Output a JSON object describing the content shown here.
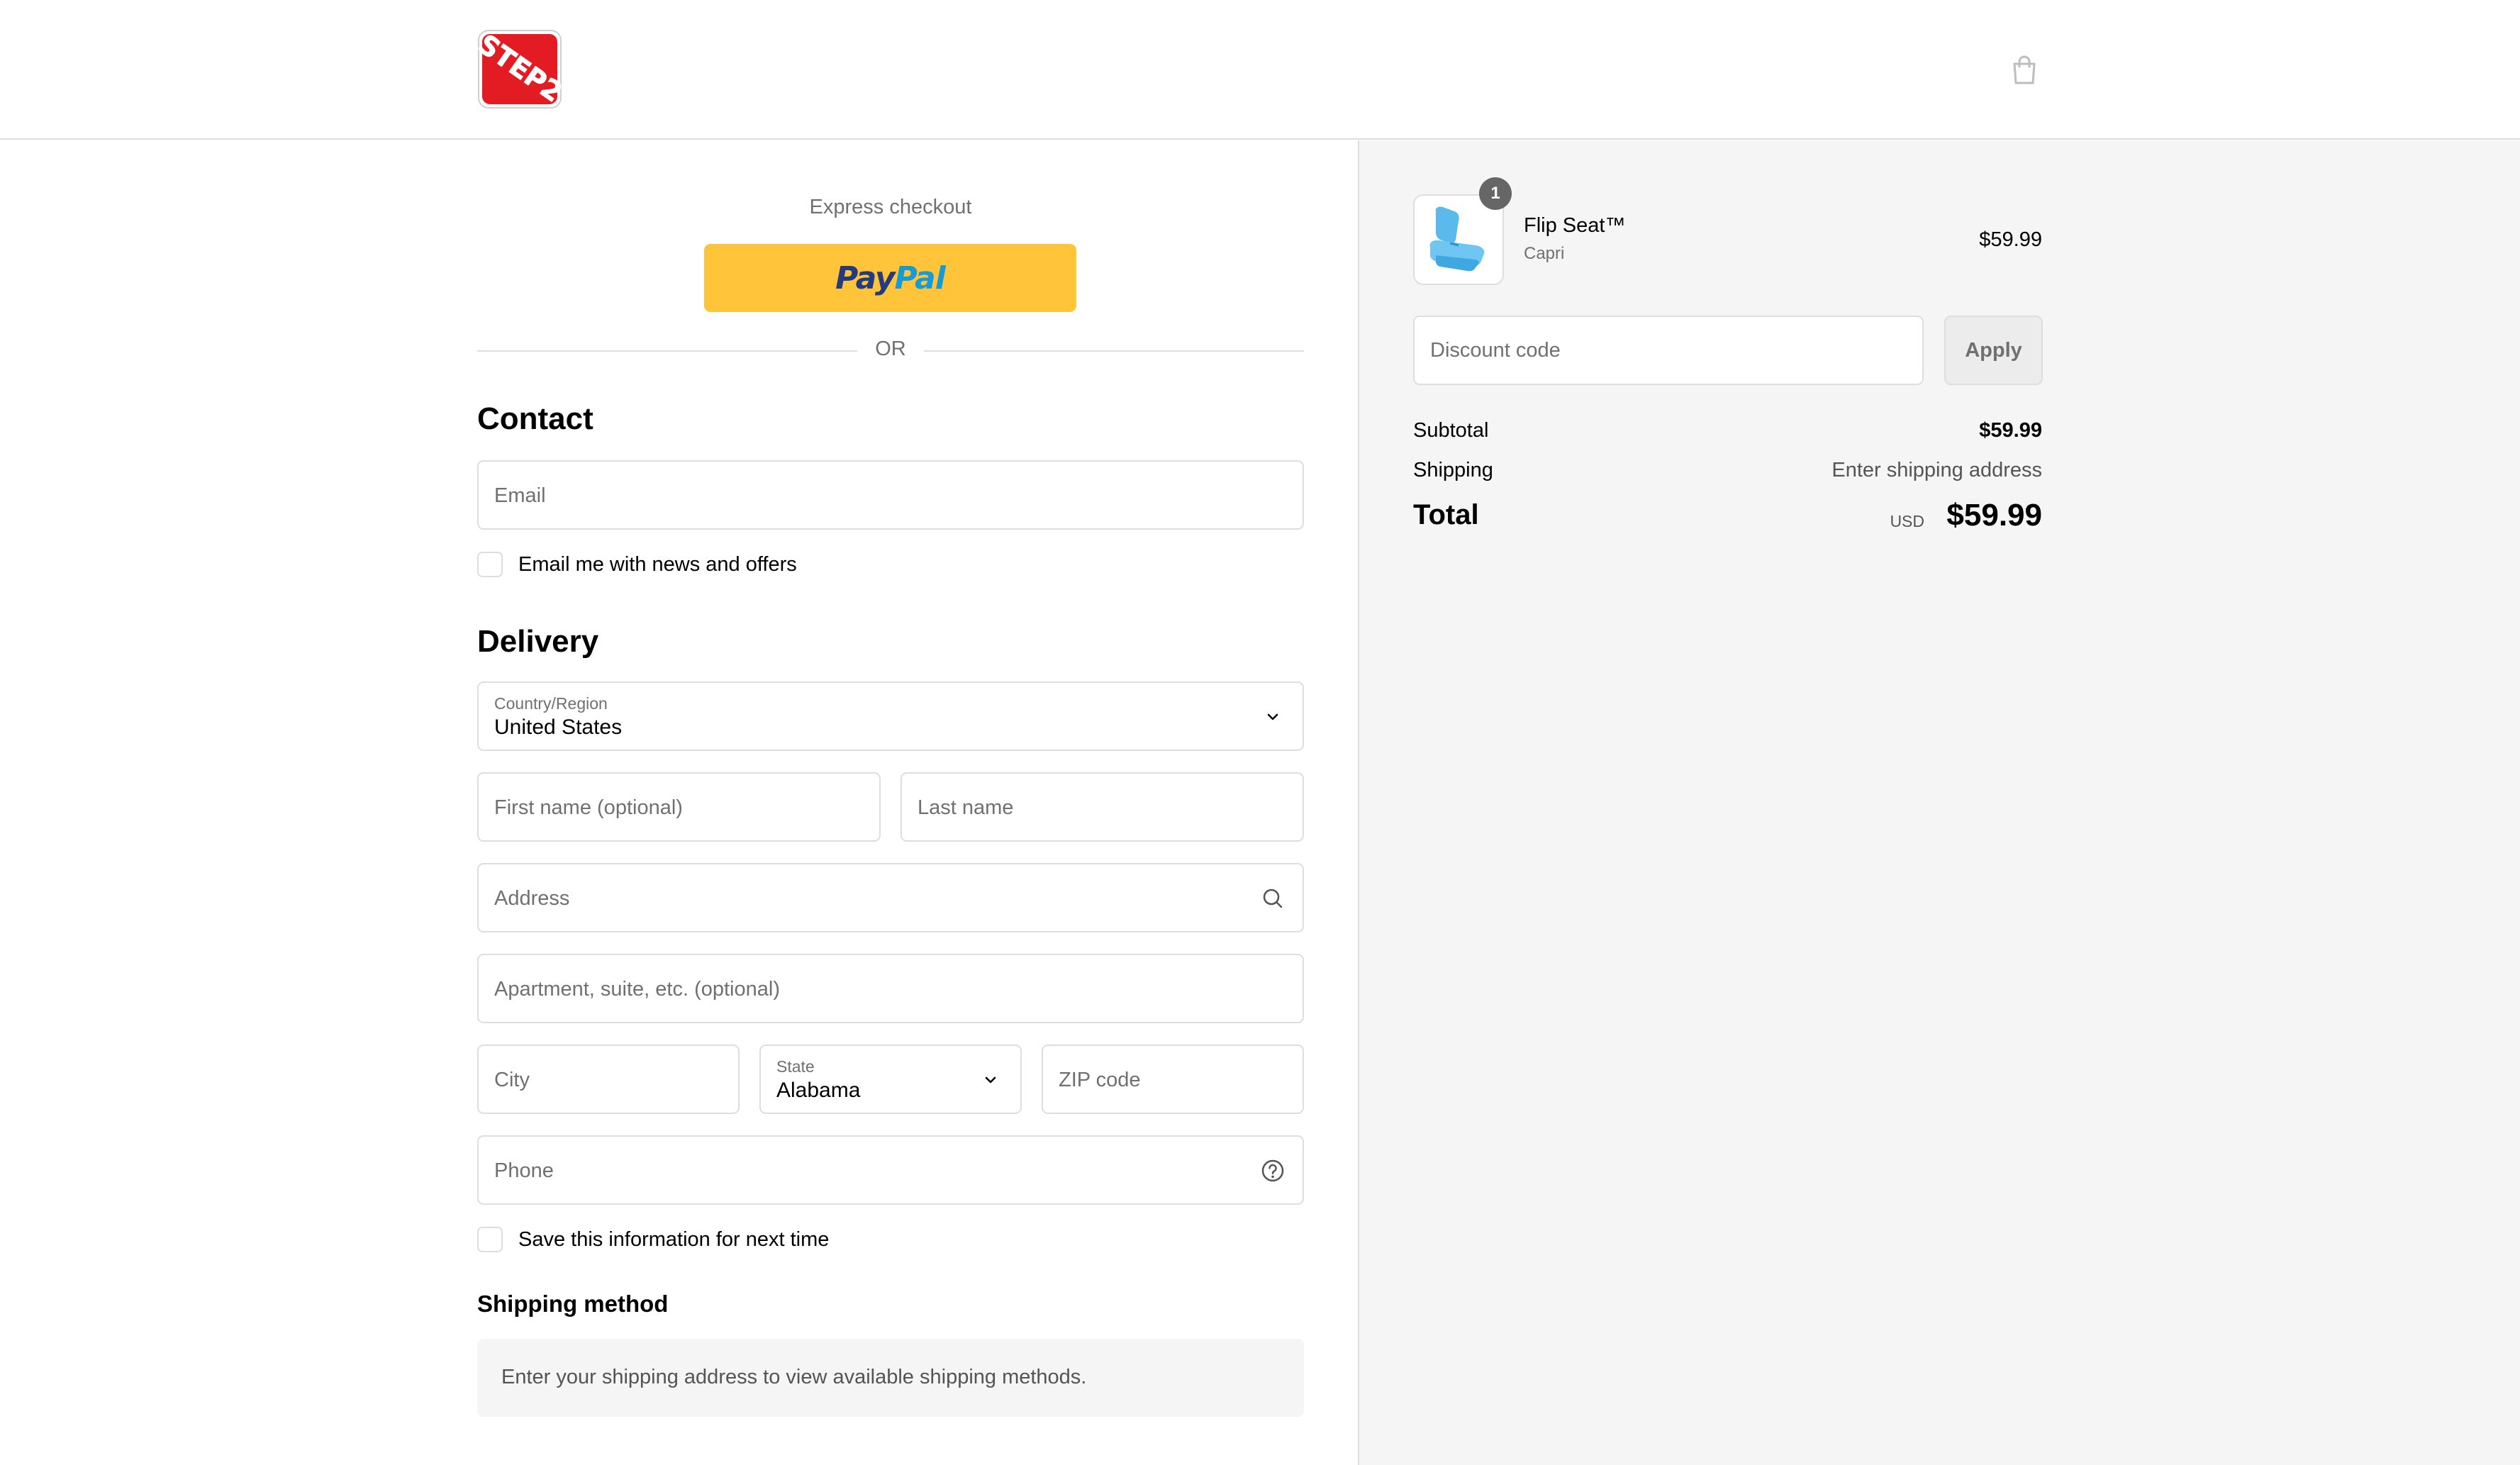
{
  "header": {
    "logo_text": "STEP2",
    "brand_color": "#e31b23",
    "cart_icon": "shopping-bag-icon"
  },
  "express": {
    "title": "Express checkout",
    "paypal_pay": "Pay",
    "paypal_pal": "Pal",
    "paypal_color": "#ffc439",
    "divider_text": "OR"
  },
  "contact": {
    "heading": "Contact",
    "email_placeholder": "Email",
    "newsletter_label": "Email me with news and offers"
  },
  "delivery": {
    "heading": "Delivery",
    "country_label": "Country/Region",
    "country_value": "United States",
    "first_name_placeholder": "First name (optional)",
    "last_name_placeholder": "Last name",
    "address_placeholder": "Address",
    "apartment_placeholder": "Apartment, suite, etc. (optional)",
    "city_placeholder": "City",
    "state_label": "State",
    "state_value": "Alabama",
    "zip_placeholder": "ZIP code",
    "phone_placeholder": "Phone",
    "save_info_label": "Save this information for next time"
  },
  "shipping_method": {
    "heading": "Shipping method",
    "info": "Enter your shipping address to view available shipping methods."
  },
  "summary": {
    "product": {
      "quantity": "1",
      "name": "Flip Seat™",
      "variant": "Capri",
      "price": "$59.99"
    },
    "discount_placeholder": "Discount code",
    "apply_label": "Apply",
    "subtotal_label": "Subtotal",
    "subtotal_value": "$59.99",
    "shipping_label": "Shipping",
    "shipping_value": "Enter shipping address",
    "total_label": "Total",
    "total_currency": "USD",
    "total_value": "$59.99"
  }
}
